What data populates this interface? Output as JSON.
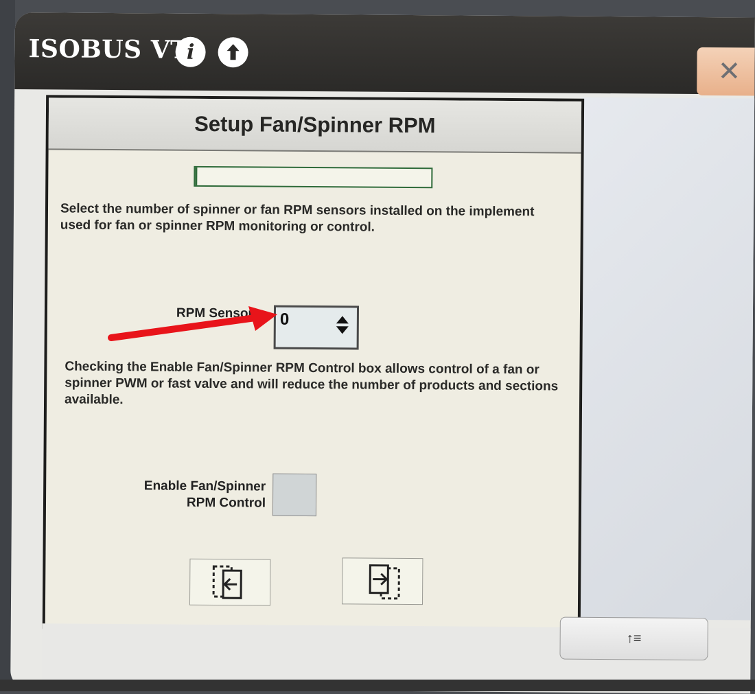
{
  "window": {
    "app_title": "ISOBUS VT",
    "info_icon": "info-icon",
    "upload_icon": "upload-icon",
    "close_icon": "close-icon",
    "close_glyph": "✕",
    "info_glyph": "i"
  },
  "dialog": {
    "title": "Setup Fan/Spinner RPM",
    "progress_fraction": 0.01,
    "instruction": "Select the number of spinner or fan RPM sensors installed on the implement used for fan or spinner RPM monitoring or control.",
    "rpm_sensors": {
      "label": "RPM Sensors",
      "value": "0"
    },
    "control_note": "Checking the Enable Fan/Spinner RPM Control box allows control of a fan or spinner PWM or fast valve and will reduce the number of products and sections available.",
    "enable_control": {
      "label_line1": "Enable Fan/Spinner",
      "label_line2": "RPM Control",
      "checked": false
    },
    "nav": {
      "back_icon": "back-page-icon",
      "next_icon": "next-page-icon"
    }
  },
  "footer": {
    "sort_icon": "sort-up-list-icon",
    "sort_glyph": "↑≡"
  },
  "annotation": {
    "color": "#e8141a",
    "type": "red-arrow"
  }
}
